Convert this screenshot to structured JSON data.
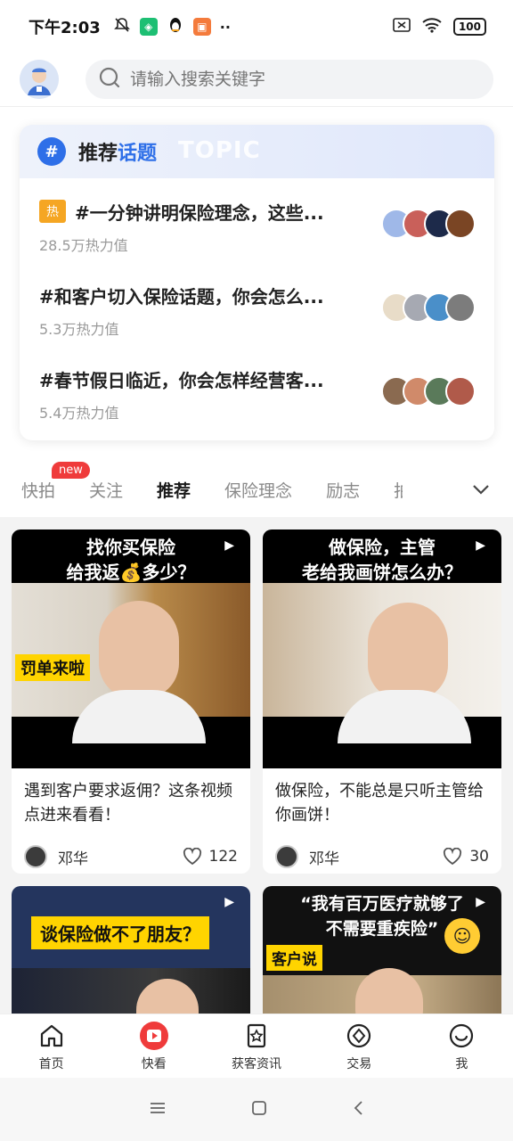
{
  "status_bar": {
    "time": "下午2:03",
    "battery": "100"
  },
  "search": {
    "placeholder": "请输入搜索关键字"
  },
  "topics": {
    "title_part1": "推荐",
    "title_part2": "话题",
    "watermark": "TOPIC",
    "hot_badge": "热",
    "items": [
      {
        "text": "#一分钟讲明保险理念，这些...",
        "heat": "28.5万热力值"
      },
      {
        "text": "#和客户切入保险话题，你会怎么...",
        "heat": "5.3万热力值"
      },
      {
        "text": "#春节假日临近，你会怎样经营客...",
        "heat": "5.4万热力值"
      }
    ]
  },
  "tabs": {
    "items": [
      "快拍",
      "关注",
      "推荐",
      "保险理念",
      "励志",
      "拍"
    ],
    "active": "推荐",
    "new_badge": "new"
  },
  "cards": [
    {
      "thumb_line1": "找你买保险",
      "thumb_line2": "给我返💰多少？",
      "sticker": "罚单来啦",
      "title": "遇到客户要求返佣？这条视频点进来看看！",
      "author": "邓华",
      "likes": "122"
    },
    {
      "thumb_line1": "做保险，主管",
      "thumb_line2": "老给我画饼怎么办？",
      "title": "做保险，不能总是只听主管给你画饼！",
      "author": "邓华",
      "likes": "30"
    },
    {
      "thumb_line1": "谈保险做不了朋友？"
    },
    {
      "thumb_line1": "“我有百万医疗就够了",
      "thumb_line2": "不需要重疾险”",
      "sticker": "客户说"
    }
  ],
  "bottom_nav": [
    "首页",
    "快看",
    "获客资讯",
    "交易",
    "我"
  ],
  "colors": {
    "accent": "#2e6fe8",
    "hot": "#f5a623",
    "new": "#ef3b3b",
    "active_nav": "#ef3b3b"
  }
}
